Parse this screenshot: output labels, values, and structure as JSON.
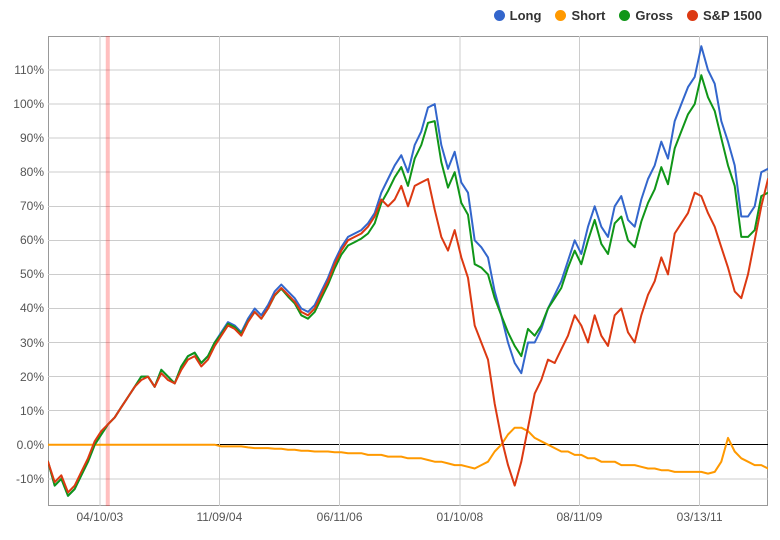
{
  "chart_data": {
    "type": "line",
    "ylabel": "",
    "xlabel": "",
    "ylim": [
      -18,
      120
    ],
    "y_ticks": [
      -10,
      0,
      10,
      20,
      30,
      40,
      50,
      60,
      70,
      80,
      90,
      100,
      110
    ],
    "y_tick_labels": [
      "-10%",
      "0.0%",
      "10%",
      "20%",
      "30%",
      "40%",
      "50%",
      "60%",
      "70%",
      "80%",
      "90%",
      "100%",
      "110%"
    ],
    "x_tick_positions": [
      0.072,
      0.238,
      0.405,
      0.572,
      0.738,
      0.905
    ],
    "x_tick_labels": [
      "04/10/03",
      "11/09/04",
      "06/11/06",
      "01/10/08",
      "08/11/09",
      "03/13/11"
    ],
    "marker_line_x": 0.083,
    "legend": [
      {
        "name": "Long",
        "color": "#3366cc"
      },
      {
        "name": "Short",
        "color": "#ff9900"
      },
      {
        "name": "Gross",
        "color": "#109618"
      },
      {
        "name": "S&P 1500",
        "color": "#dc3912"
      }
    ],
    "series": [
      {
        "name": "Long",
        "color": "#3366cc",
        "values": [
          -5,
          -12,
          -10,
          -15,
          -13,
          -9,
          -5,
          0,
          3,
          6,
          8,
          11,
          14,
          17,
          20,
          20,
          17,
          22,
          20,
          18,
          23,
          26,
          27,
          24,
          26,
          30,
          33,
          36,
          35,
          33,
          37,
          40,
          38,
          41,
          45,
          47,
          45,
          43,
          40,
          39,
          41,
          45,
          49,
          54,
          58,
          61,
          62,
          63,
          65,
          68,
          74,
          78,
          82,
          85,
          80,
          88,
          92,
          99,
          100,
          88,
          81,
          86,
          77,
          74,
          60,
          58,
          55,
          45,
          38,
          30,
          24,
          21,
          30,
          30,
          34,
          40,
          44,
          48,
          54,
          60,
          56,
          64,
          70,
          64,
          61,
          70,
          73,
          66,
          64,
          72,
          78,
          82,
          89,
          84,
          95,
          100,
          105,
          108,
          117,
          110,
          106,
          95,
          89,
          82,
          67,
          67,
          70,
          80,
          81
        ]
      },
      {
        "name": "Short",
        "color": "#ff9900",
        "values": [
          0,
          0,
          0,
          0,
          0,
          0,
          0,
          0,
          0,
          0,
          0,
          0,
          0,
          0,
          0,
          0,
          0,
          0,
          0,
          0,
          0,
          0,
          0,
          0,
          0,
          0,
          -0.5,
          -0.5,
          -0.5,
          -0.5,
          -0.8,
          -1,
          -1,
          -1,
          -1.2,
          -1.2,
          -1.5,
          -1.5,
          -1.8,
          -1.8,
          -2,
          -2,
          -2,
          -2.2,
          -2.2,
          -2.5,
          -2.5,
          -2.5,
          -3,
          -3,
          -3,
          -3.5,
          -3.5,
          -3.5,
          -4,
          -4,
          -4,
          -4.5,
          -5,
          -5,
          -5.5,
          -6,
          -6,
          -6.5,
          -7,
          -6,
          -5,
          -2,
          0,
          3,
          5,
          5,
          4,
          2,
          1,
          0,
          -1,
          -2,
          -2,
          -3,
          -3,
          -4,
          -4,
          -5,
          -5,
          -5,
          -6,
          -6,
          -6,
          -6.5,
          -7,
          -7,
          -7.5,
          -7.5,
          -8,
          -8,
          -8,
          -8,
          -8,
          -8.5,
          -8,
          -5,
          2,
          -2,
          -4,
          -5,
          -6,
          -6,
          -7
        ]
      },
      {
        "name": "Gross",
        "color": "#109618",
        "values": [
          -5,
          -12,
          -10,
          -15,
          -13,
          -9,
          -5,
          0,
          3,
          6,
          8,
          11,
          14,
          17,
          20,
          20,
          17,
          22,
          20,
          18,
          23,
          26,
          27,
          24,
          26,
          30,
          32.5,
          35.5,
          34.5,
          32.5,
          36.2,
          39,
          37,
          40,
          43.8,
          45.8,
          43.5,
          41.5,
          38,
          37,
          39,
          43,
          47,
          51.8,
          55.8,
          58.5,
          59.5,
          60.5,
          62,
          65,
          71,
          74.5,
          78.5,
          81.5,
          76,
          84,
          88,
          94.5,
          95,
          83,
          75.5,
          80,
          71,
          67.5,
          53,
          52,
          50,
          43,
          38,
          33,
          29,
          26,
          34,
          32,
          35,
          40,
          43,
          46,
          52,
          57,
          53,
          60,
          66,
          59,
          56,
          65,
          67,
          60,
          58,
          65.5,
          71,
          75,
          81.5,
          76.5,
          87,
          92,
          97,
          100,
          108.5,
          102,
          98,
          90,
          82,
          76,
          61,
          61,
          63,
          73,
          74
        ]
      },
      {
        "name": "S&P 1500",
        "color": "#dc3912",
        "values": [
          -5,
          -11,
          -9,
          -14,
          -12,
          -8,
          -4,
          1,
          4,
          6,
          8,
          11,
          14,
          17,
          19,
          20,
          17,
          21,
          19,
          18,
          22,
          25,
          26,
          23,
          25,
          29,
          32,
          35,
          34,
          32,
          36,
          39,
          37,
          40,
          44,
          46,
          44,
          42,
          39,
          38,
          40,
          44,
          48,
          53,
          57,
          60,
          61,
          62,
          64,
          67,
          72,
          70,
          72,
          76,
          70,
          76,
          77,
          78,
          69,
          61,
          57,
          63,
          55,
          49,
          35,
          30,
          25,
          12,
          2,
          -6,
          -12,
          -5,
          5,
          15,
          19,
          25,
          24,
          28,
          32,
          38,
          35,
          30,
          38,
          32,
          29,
          38,
          40,
          33,
          30,
          38,
          44,
          48,
          55,
          50,
          62,
          65,
          68,
          74,
          73,
          68,
          64,
          58,
          52,
          45,
          43,
          50,
          60,
          70,
          78
        ]
      }
    ]
  }
}
